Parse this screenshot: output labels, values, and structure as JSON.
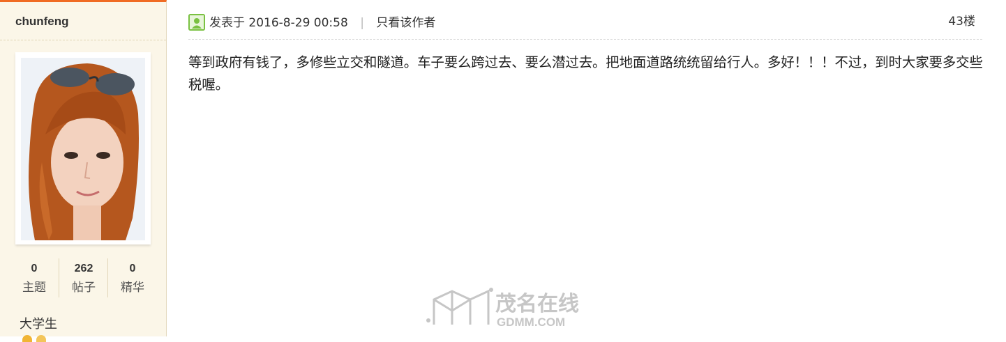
{
  "author": {
    "name": "chunfeng",
    "stats": [
      {
        "value": "0",
        "label": "主题"
      },
      {
        "value": "262",
        "label": "帖子"
      },
      {
        "value": "0",
        "label": "精华"
      }
    ],
    "rank": "大学生"
  },
  "post": {
    "posted_prefix": "发表于",
    "datetime": "2016-8-29 00:58",
    "only_author_link": "只看该作者",
    "floor": "43楼",
    "content": "等到政府有钱了，多修些立交和隧道。车子要么跨过去、要么潜过去。把地面道路统统留给行人。多好！！！不过，到时大家要多交些税喔。"
  },
  "watermark": {
    "cn": "茂名在线",
    "en": "GDMM.COM"
  },
  "colors": {
    "sidebar_bg": "#fbf6e8",
    "accent_top": "#f06b23",
    "online_icon": "#7ac142",
    "watermark": "#c8c8c8"
  },
  "icons": [
    "online-status-icon",
    "medal-icon"
  ]
}
